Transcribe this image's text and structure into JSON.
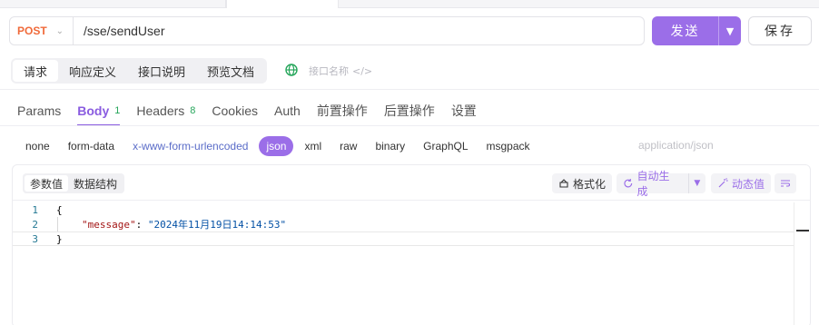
{
  "request": {
    "method": "POST",
    "url": "/sse/sendUser",
    "send_label": "发送",
    "save_label": "保存"
  },
  "mode_tabs": [
    {
      "label": "请求",
      "active": true
    },
    {
      "label": "响应定义",
      "active": false
    },
    {
      "label": "接口说明",
      "active": false
    },
    {
      "label": "预览文档",
      "active": false
    }
  ],
  "api_name_placeholder": "接口名称",
  "request_tabs": [
    {
      "label": "Params",
      "count": "",
      "active": false
    },
    {
      "label": "Body",
      "count": "1",
      "active": true
    },
    {
      "label": "Headers",
      "count": "8",
      "active": false
    },
    {
      "label": "Cookies",
      "count": "",
      "active": false
    },
    {
      "label": "Auth",
      "count": "",
      "active": false
    },
    {
      "label": "前置操作",
      "count": "",
      "active": false
    },
    {
      "label": "后置操作",
      "count": "",
      "active": false
    },
    {
      "label": "设置",
      "count": "",
      "active": false
    }
  ],
  "body_types": [
    "none",
    "form-data",
    "x-www-form-urlencoded",
    "json",
    "xml",
    "raw",
    "binary",
    "GraphQL",
    "msgpack"
  ],
  "body_type_selected": "json",
  "content_type": "application/json",
  "sub_tabs": [
    {
      "label": "参数值",
      "active": true
    },
    {
      "label": "数据结构",
      "active": false
    }
  ],
  "toolbar": {
    "format_label": "格式化",
    "auto_generate_label": "自动生成",
    "dynamic_value_label": "动态值"
  },
  "code": {
    "line_numbers": [
      "1",
      "2",
      "3"
    ],
    "open_brace": "{",
    "key": "\"message\"",
    "colon": ": ",
    "value": "\"2024年11月19日14:14:53\"",
    "close_brace": "}"
  },
  "colors": {
    "accent": "#9b6ee8",
    "method": "#f06a3a",
    "count": "#26a65b",
    "link": "#5a6cc8"
  }
}
